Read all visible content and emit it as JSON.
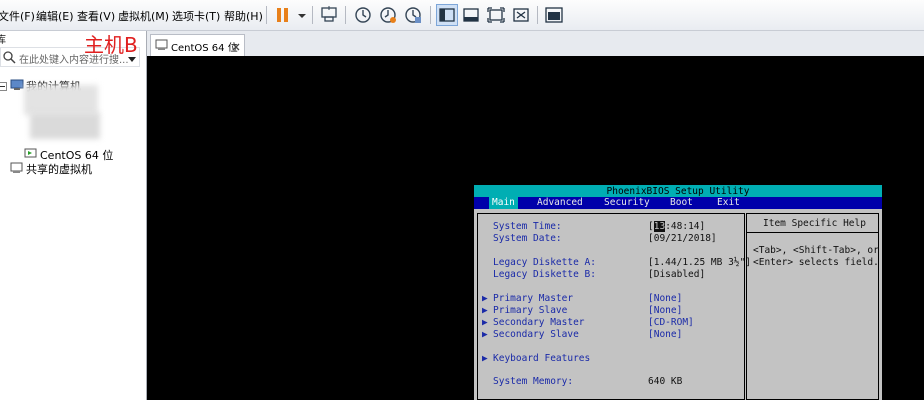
{
  "menu": {
    "items": [
      "文件(F)",
      "编辑(E)",
      "查看(V)",
      "虚拟机(M)",
      "选项卡(T)",
      "帮助(H)"
    ]
  },
  "toolbar": {
    "icons": [
      "pause-icon",
      "send-ctrl-alt-del-icon",
      "snapshot-icon",
      "revert-snapshot-icon",
      "manage-snapshots-icon",
      "show-library-icon",
      "thumbnail-bar-icon",
      "fullscreen-icon",
      "unity-icon",
      "console-view-icon"
    ]
  },
  "annotation": {
    "text": "主机B",
    "color": "#e02020"
  },
  "sidebar": {
    "header": "库",
    "search_placeholder": "在此处键入内容进行搜...",
    "tree": {
      "my_computer": "我的计算机",
      "centos": "CentOS 64 位",
      "shared": "共享的虚拟机"
    }
  },
  "tab": {
    "label": "CentOS 64 位"
  },
  "bios": {
    "title": "PhoenixBIOS Setup Utility",
    "menus": [
      "Main",
      "Advanced",
      "Security",
      "Boot",
      "Exit"
    ],
    "selected_menu": "Main",
    "fields": [
      {
        "label": "System Time:",
        "value_cursor": "13",
        "value": ":48:14]"
      },
      {
        "label": "System Date:",
        "value": "[09/21/2018]"
      },
      {
        "label": "Legacy Diskette A:",
        "value": "[1.44/1.25 MB  3½\"]"
      },
      {
        "label": "Legacy Diskette B:",
        "value": "[Disabled]"
      },
      {
        "label": "Primary Master",
        "value": "[None]"
      },
      {
        "label": "Primary Slave",
        "value": "[None]"
      },
      {
        "label": "Secondary Master",
        "value": "[CD-ROM]"
      },
      {
        "label": "Secondary Slave",
        "value": "[None]"
      },
      {
        "label": "Keyboard Features",
        "value": ""
      },
      {
        "label": "System Memory:",
        "value": "640 KB"
      }
    ],
    "help_title": "Item Specific Help",
    "help_line1": "<Tab>, <Shift-Tab>, or",
    "help_line2": "<Enter> selects field.",
    "colors": {
      "frame": "#00aeb3",
      "menubar": "#0000aa",
      "body": "#c3c3c3",
      "label": "#1a2aa8"
    }
  }
}
